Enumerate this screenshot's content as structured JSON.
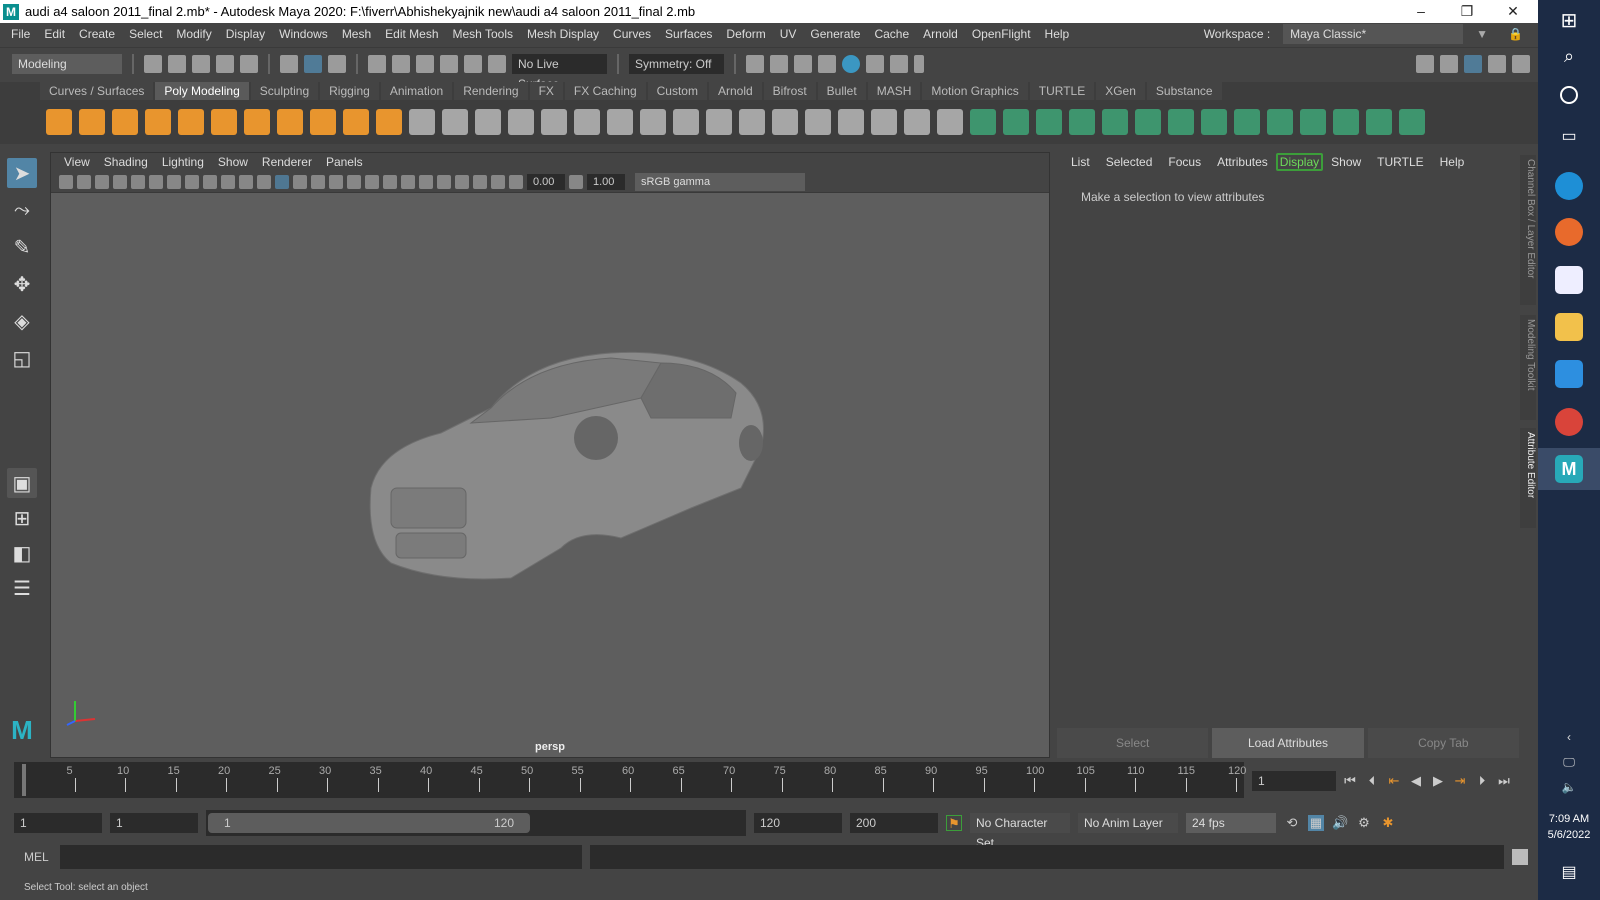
{
  "title": "audi a4 saloon 2011_final 2.mb* - Autodesk Maya 2020: F:\\fiverr\\Abhishekyajnik new\\audi a4 saloon 2011_final 2.mb",
  "app_logo": "M",
  "menu": [
    "File",
    "Edit",
    "Create",
    "Select",
    "Modify",
    "Display",
    "Windows",
    "Mesh",
    "Edit Mesh",
    "Mesh Tools",
    "Mesh Display",
    "Curves",
    "Surfaces",
    "Deform",
    "UV",
    "Generate",
    "Cache",
    "Arnold",
    "OpenFlight",
    "Help"
  ],
  "workspace": {
    "label": "Workspace :",
    "value": "Maya Classic*"
  },
  "statusline": {
    "menuset": "Modeling",
    "live_surface": "No Live Surface",
    "symmetry": "Symmetry: Off"
  },
  "shelf_tabs": [
    "Curves / Surfaces",
    "Poly Modeling",
    "Sculpting",
    "Rigging",
    "Animation",
    "Rendering",
    "FX",
    "FX Caching",
    "Custom",
    "Arnold",
    "Bifrost",
    "Bullet",
    "MASH",
    "Motion Graphics",
    "TURTLE",
    "XGen",
    "Substance"
  ],
  "shelf_active": "Poly Modeling",
  "viewport": {
    "menu": [
      "View",
      "Shading",
      "Lighting",
      "Show",
      "Renderer",
      "Panels"
    ],
    "exposure": "0.00",
    "gamma": "1.00",
    "colorspace": "sRGB gamma",
    "camera": "persp"
  },
  "attribute_editor": {
    "menu": [
      "List",
      "Selected",
      "Focus",
      "Attributes",
      "Display",
      "Show",
      "TURTLE",
      "Help"
    ],
    "message": "Make a selection to view attributes",
    "buttons": [
      "Select",
      "Load Attributes",
      "Copy Tab"
    ]
  },
  "side_tabs": [
    "Channel Box / Layer Editor",
    "Modeling Toolkit",
    "Attribute Editor"
  ],
  "timeline": {
    "ticks": [
      "5",
      "10",
      "15",
      "20",
      "25",
      "30",
      "35",
      "40",
      "45",
      "50",
      "55",
      "60",
      "65",
      "70",
      "75",
      "80",
      "85",
      "90",
      "95",
      "100",
      "105",
      "110",
      "115",
      "120"
    ],
    "current_frame": "1"
  },
  "range": {
    "start": "1",
    "playback_start": "1",
    "slider_min": "1",
    "slider_max": "120",
    "playback_end": "120",
    "end": "200",
    "character_set": "No Character Set",
    "anim_layer": "No Anim Layer",
    "fps": "24 fps"
  },
  "command": {
    "label": "MEL"
  },
  "help_line": "Select Tool: select an object",
  "clock": {
    "time": "7:09 AM",
    "date": "5/6/2022"
  },
  "colors": {
    "accent": "#5285a6",
    "shelf_orange": "#e8952e",
    "taskbar": "#1c2b45"
  }
}
